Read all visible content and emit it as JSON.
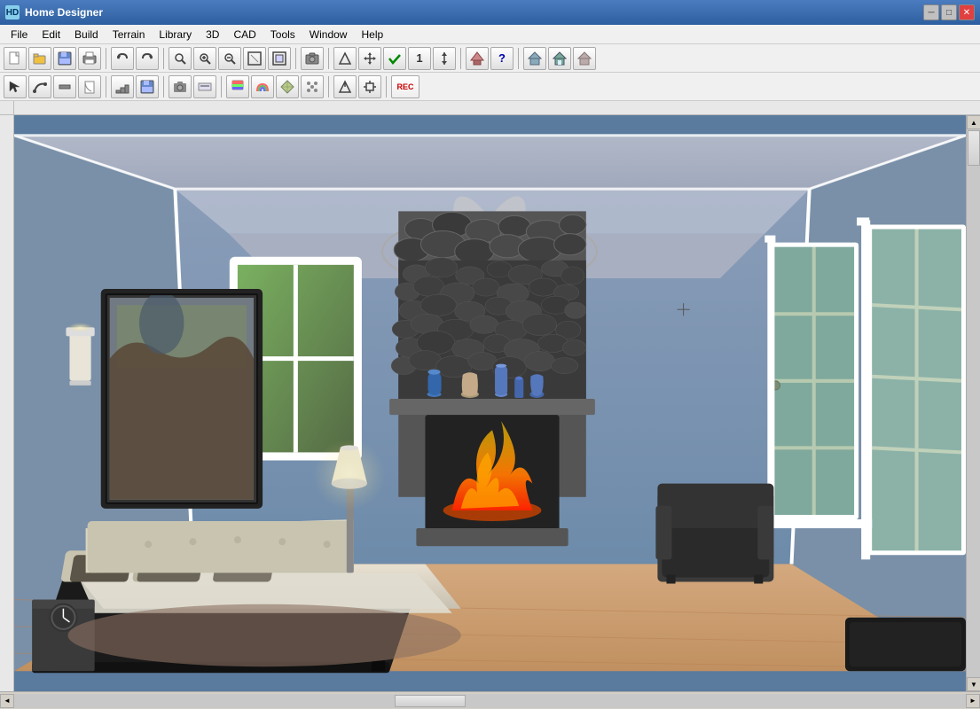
{
  "titleBar": {
    "title": "Home Designer",
    "iconLabel": "HD",
    "minimizeLabel": "─",
    "maximizeLabel": "□",
    "closeLabel": "✕"
  },
  "menuBar": {
    "items": [
      "File",
      "Edit",
      "Build",
      "Terrain",
      "Library",
      "3D",
      "CAD",
      "Tools",
      "Window",
      "Help"
    ]
  },
  "toolbar1": {
    "buttons": [
      {
        "name": "new",
        "icon": "📄"
      },
      {
        "name": "open",
        "icon": "📂"
      },
      {
        "name": "save",
        "icon": "💾"
      },
      {
        "name": "print",
        "icon": "🖨"
      },
      {
        "name": "undo",
        "icon": "↩"
      },
      {
        "name": "redo",
        "icon": "↪"
      },
      {
        "name": "zoom-out-small",
        "icon": "🔍"
      },
      {
        "name": "zoom-in",
        "icon": "🔍+"
      },
      {
        "name": "zoom-out",
        "icon": "🔍-"
      },
      {
        "name": "fit-view",
        "icon": "⊞"
      },
      {
        "name": "view-grid",
        "icon": "⊡"
      },
      {
        "name": "camera",
        "icon": "📷"
      },
      {
        "name": "arrow-up",
        "icon": "↑"
      },
      {
        "name": "arrows-lr",
        "icon": "↔"
      },
      {
        "name": "check",
        "icon": "✓"
      },
      {
        "name": "measure",
        "icon": "1"
      },
      {
        "name": "height",
        "icon": "↕"
      },
      {
        "name": "roof",
        "icon": "⌂"
      },
      {
        "name": "help",
        "icon": "?"
      },
      {
        "name": "sep1",
        "type": "separator"
      },
      {
        "name": "house1",
        "icon": "🏠"
      },
      {
        "name": "house2",
        "icon": "🏡"
      },
      {
        "name": "house3",
        "icon": "⌂"
      }
    ]
  },
  "toolbar2": {
    "buttons": [
      {
        "name": "select",
        "icon": "↖"
      },
      {
        "name": "polyline",
        "icon": "⌒"
      },
      {
        "name": "wall",
        "icon": "═"
      },
      {
        "name": "door",
        "icon": "▣"
      },
      {
        "name": "stairs",
        "icon": "⌇"
      },
      {
        "name": "save2",
        "icon": "💾"
      },
      {
        "name": "camera2",
        "icon": "📷"
      },
      {
        "name": "dimensions",
        "icon": "◫"
      },
      {
        "name": "paint",
        "icon": "🖌"
      },
      {
        "name": "rainbow",
        "icon": "🌈"
      },
      {
        "name": "texture",
        "icon": "⬡"
      },
      {
        "name": "scatter",
        "icon": "⁖"
      },
      {
        "name": "arrow-up2",
        "icon": "↑"
      },
      {
        "name": "transform",
        "icon": "⤡"
      },
      {
        "name": "rec",
        "icon": "REC"
      }
    ]
  },
  "scene": {
    "description": "3D bedroom interior render showing a master bedroom with fireplace, bed, windows and french doors"
  },
  "scrollbar": {
    "upArrow": "▲",
    "downArrow": "▼",
    "leftArrow": "◄",
    "rightArrow": "►"
  }
}
